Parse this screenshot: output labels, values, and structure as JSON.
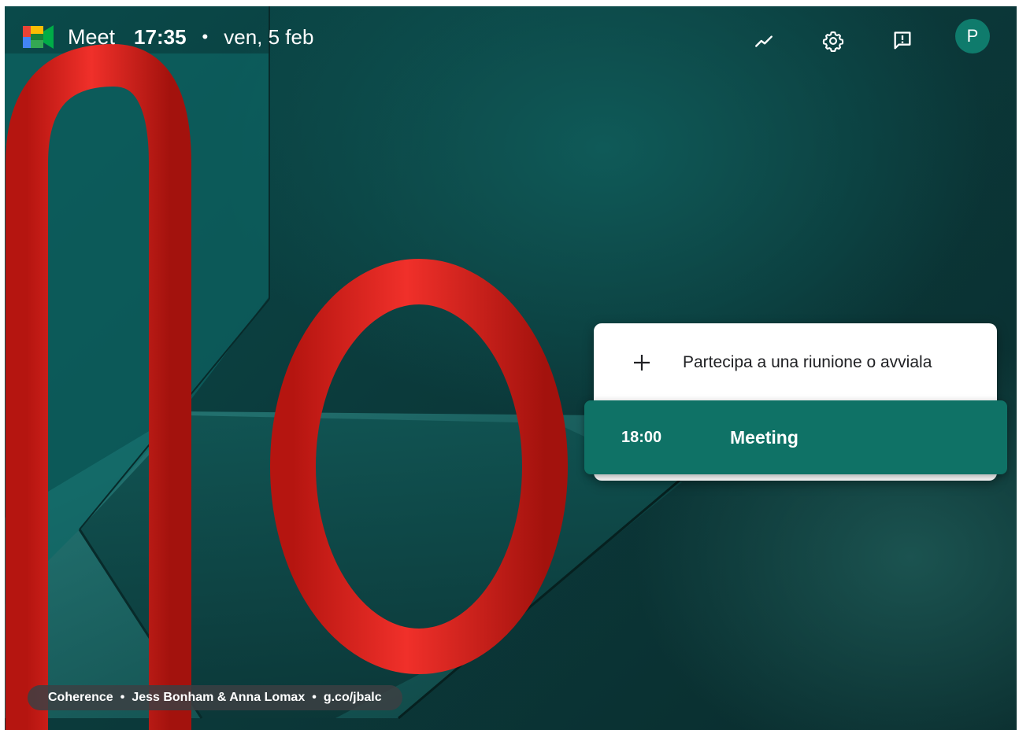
{
  "topbar": {
    "app_name": "Meet",
    "time": "17:35",
    "separator": "•",
    "date": "ven, 5 feb",
    "icons": [
      "activity-icon",
      "settings-icon",
      "feedback-icon"
    ],
    "avatar_initial": "P",
    "avatar_color": "#0f7b6c"
  },
  "card": {
    "join_icon": "plus-icon",
    "join_label": "Partecipa a una riunione o avviala",
    "meeting": {
      "time": "18:00",
      "title": "Meeting",
      "color": "#0f7266"
    }
  },
  "credit": {
    "title": "Coherence",
    "dot": "•",
    "artists": "Jess Bonham & Anna Lomax",
    "link": "g.co/jbalc"
  },
  "colors": {
    "background": "#0b3a3b",
    "accent_red": "#e52a20"
  }
}
